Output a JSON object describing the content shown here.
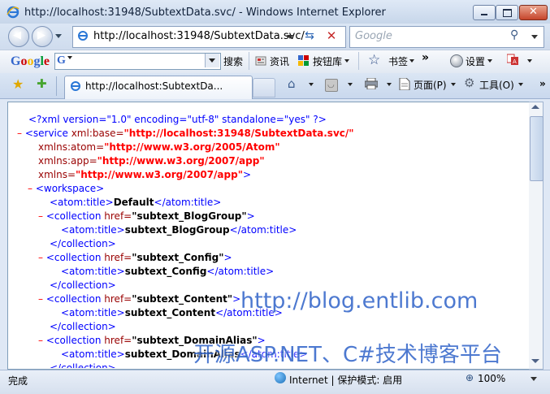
{
  "window": {
    "title": "http://localhost:31948/SubtextData.svc/ - Windows Internet Explorer"
  },
  "address": {
    "url": "http://localhost:31948/SubtextData.svc/"
  },
  "search": {
    "placeholder": "Google"
  },
  "google_toolbar": {
    "logo": "Google",
    "search_letter": "G",
    "search_label": "搜索",
    "news_label": "资讯",
    "blocker_label": "按钮库",
    "bookmarks_label": "书签",
    "more": "»",
    "settings_label": "设置",
    "logo_colors": [
      "#3366cc",
      "#cc0000",
      "#f5b800",
      "#3366cc",
      "#009933",
      "#cc0000"
    ]
  },
  "tabs": [
    {
      "label": "http://localhost:SubtextDa..."
    }
  ],
  "command_bar": {
    "page_label": "页面(P)",
    "tools_label": "工具(O)"
  },
  "xml": {
    "pi": "<?xml version=\"1.0\" encoding=\"utf-8\" standalone=\"yes\" ?>",
    "service_open": "<service",
    "service_base_attr": " xml:base=",
    "service_base_val": "\"http://localhost:31948/SubtextData.svc/\"",
    "ns_atom_attr": "xmlns:atom=",
    "ns_atom_val": "\"http://www.w3.org/2005/Atom\"",
    "ns_app_attr": "xmlns:app=",
    "ns_app_val": "\"http://www.w3.org/2007/app\"",
    "ns_attr": "xmlns=",
    "ns_val": "\"http://www.w3.org/2007/app\"",
    "ns_close": ">",
    "workspace_open": "<workspace>",
    "title_open": "<atom:title>",
    "title_close": "</atom:title>",
    "workspace_title": "Default",
    "collection_open": "<collection",
    "href_attr": " href=",
    "collection_close": "</collection>",
    "minus": "–",
    "collections": [
      {
        "href": "\"subtext_BlogGroup\"",
        "title": "subtext_BlogGroup"
      },
      {
        "href": "\"subtext_Config\"",
        "title": "subtext_Config"
      },
      {
        "href": "\"subtext_Content\"",
        "title": "subtext_Content"
      },
      {
        "href": "\"subtext_DomainAlias\"",
        "title": "subtext_DomainAlias"
      }
    ]
  },
  "status": {
    "text": "完成",
    "zone": "Internet | 保护模式: 启用",
    "zoom": "100%"
  },
  "watermark": {
    "line1": "http://blog.entlib.com",
    "line2": "开源ASP.NET、C#技术博客平台"
  }
}
